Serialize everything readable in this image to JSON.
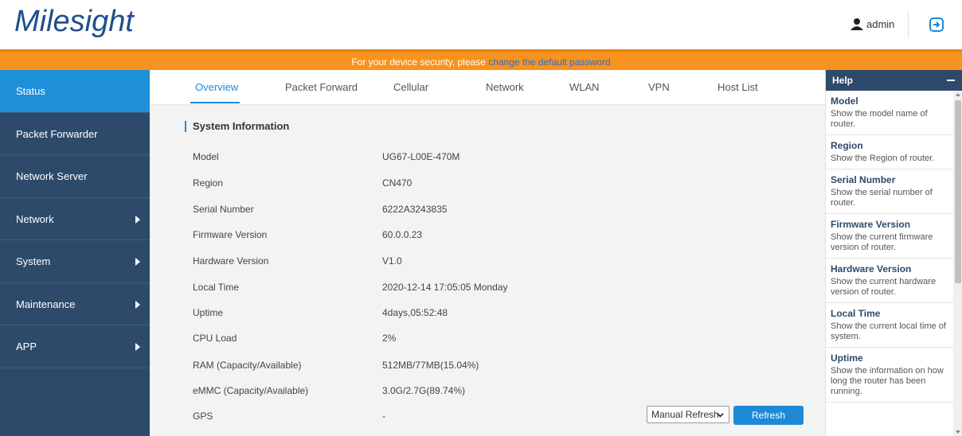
{
  "brand": {
    "logo": "Milesight"
  },
  "user": {
    "name": "admin"
  },
  "banner": {
    "text": "For your device security, please ",
    "link": "change the default password"
  },
  "sidebar": {
    "items": [
      {
        "label": "Status"
      },
      {
        "label": "Packet Forwarder"
      },
      {
        "label": "Network Server"
      },
      {
        "label": "Network"
      },
      {
        "label": "System"
      },
      {
        "label": "Maintenance"
      },
      {
        "label": "APP"
      }
    ]
  },
  "tabs": [
    {
      "label": "Overview"
    },
    {
      "label": "Packet Forward"
    },
    {
      "label": "Cellular"
    },
    {
      "label": "Network"
    },
    {
      "label": "WLAN"
    },
    {
      "label": "VPN"
    },
    {
      "label": "Host List"
    }
  ],
  "system_info": {
    "title": "System Information",
    "rows": [
      {
        "label": "Model",
        "value": "UG67-L00E-470M"
      },
      {
        "label": "Region",
        "value": "CN470"
      },
      {
        "label": "Serial Number",
        "value": "6222A3243835"
      },
      {
        "label": "Firmware Version",
        "value": "60.0.0.23"
      },
      {
        "label": "Hardware Version",
        "value": "V1.0"
      },
      {
        "label": "Local Time",
        "value": "2020-12-14 17:05:05 Monday"
      },
      {
        "label": "Uptime",
        "value": "4days,05:52:48"
      },
      {
        "label": "CPU Load",
        "value": "2%"
      },
      {
        "label": "RAM (Capacity/Available)",
        "value": "512MB/77MB(15.04%)"
      },
      {
        "label": "eMMC (Capacity/Available)",
        "value": "3.0G/2.7G(89.74%)"
      },
      {
        "label": "GPS",
        "value": "-"
      }
    ]
  },
  "refresh": {
    "select_value": "Manual Refresh",
    "button_label": "Refresh"
  },
  "help": {
    "title": "Help",
    "items": [
      {
        "title": "Model",
        "desc": "Show the model name of router."
      },
      {
        "title": "Region",
        "desc": "Show the Region of router."
      },
      {
        "title": "Serial Number",
        "desc": "Show the serial number of router."
      },
      {
        "title": "Firmware Version",
        "desc": "Show the current firmware version of router."
      },
      {
        "title": "Hardware Version",
        "desc": "Show the current hardware version of router."
      },
      {
        "title": "Local Time",
        "desc": "Show the current local time of system."
      },
      {
        "title": "Uptime",
        "desc": "Show the information on how long the router has been running."
      }
    ]
  },
  "colors": {
    "accent": "#1e8ad6",
    "banner": "#f7931e",
    "sidebar": "#2d4a6b"
  }
}
